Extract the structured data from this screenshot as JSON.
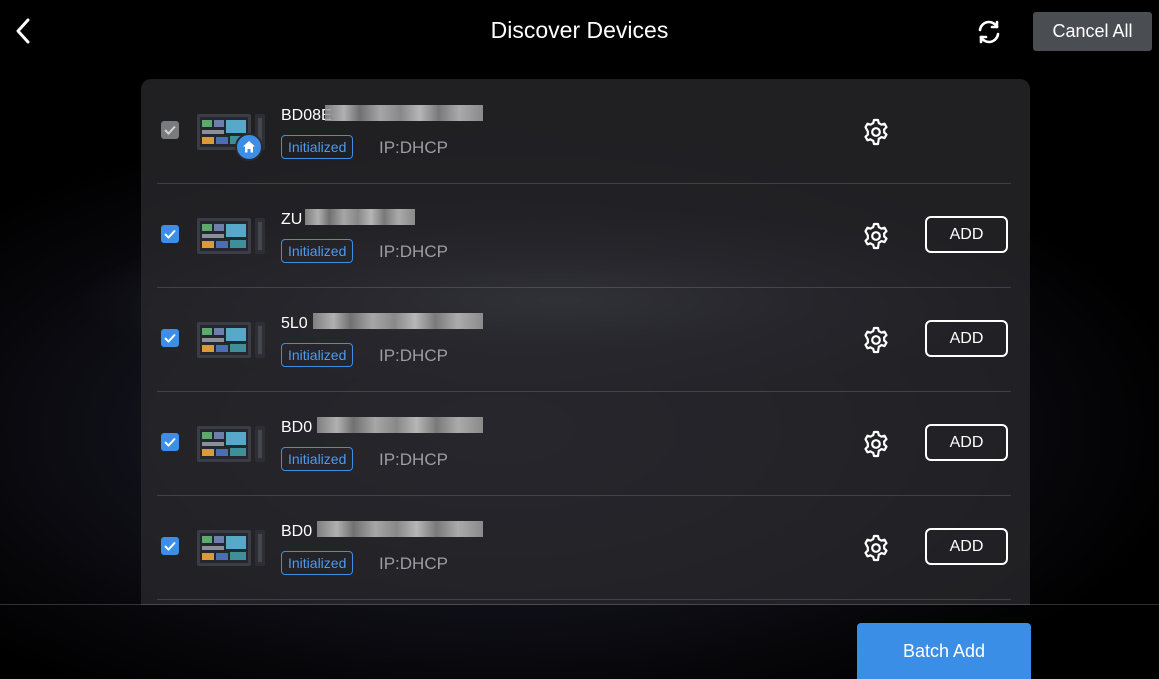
{
  "header": {
    "title": "Discover Devices",
    "cancel_all_label": "Cancel All",
    "back_icon": "chevron-left-icon",
    "refresh_icon": "refresh-icon"
  },
  "devices": [
    {
      "name": "BD08E",
      "status": "Initialized",
      "ip": "IP:DHCP",
      "checked": true,
      "disabled": true,
      "has_add": false,
      "add_label": ""
    },
    {
      "name": "ZU",
      "status": "Initialized",
      "ip": "IP:DHCP",
      "checked": true,
      "disabled": false,
      "has_add": true,
      "add_label": "ADD"
    },
    {
      "name": "5L0",
      "status": "Initialized",
      "ip": "IP:DHCP",
      "checked": true,
      "disabled": false,
      "has_add": true,
      "add_label": "ADD"
    },
    {
      "name": "BD0",
      "status": "Initialized",
      "ip": "IP:DHCP",
      "checked": true,
      "disabled": false,
      "has_add": true,
      "add_label": "ADD"
    },
    {
      "name": "BD0",
      "status": "Initialized",
      "ip": "IP:DHCP",
      "checked": true,
      "disabled": false,
      "has_add": true,
      "add_label": "ADD"
    }
  ],
  "footer": {
    "batch_add_label": "Batch Add"
  },
  "colors": {
    "accent": "#3b8ee6",
    "background": "#000000",
    "panel": "#28282c",
    "cancel_button": "#4a4d52"
  }
}
